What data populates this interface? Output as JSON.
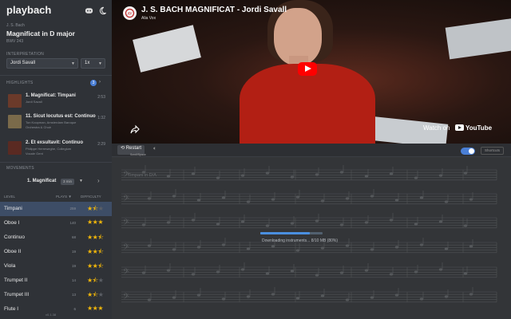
{
  "brand": "playbach",
  "piece": {
    "composer": "J. S. Bach",
    "title": "Magnificat in D major",
    "bwv": "BWV 243"
  },
  "interpretation": {
    "label": "INTERPRETATION",
    "performer": "Jordi Savall",
    "speed": "1x"
  },
  "highlights": {
    "label": "HIGHLIGHTS",
    "count": "3",
    "items": [
      {
        "title": "1. Magnificat: Timpani",
        "sub1": "Jordi Savall",
        "sub2": "",
        "time": "2:53"
      },
      {
        "title": "11. Sicut locutus est: Continuo",
        "sub1": "Ton Koopman, Amsterdam Baroque",
        "sub2": "Orchestra & Choir",
        "time": "1:32"
      },
      {
        "title": "2. Et exsultavit: Continuo",
        "sub1": "Philippe Herreweghe, Collegium",
        "sub2": "Vocale Gent",
        "time": "2:29"
      }
    ]
  },
  "movements": {
    "label": "MOVEMENTS",
    "current": "1. Magnificat",
    "tag": "3 min",
    "next_icon": "chevron-right"
  },
  "table": {
    "col_level": "LEVEL",
    "col_plays": "PLAYS ▼",
    "col_difficulty": "DIFFICULTY",
    "rows": [
      {
        "name": "Timpani",
        "plays": "259",
        "stars": 1,
        "half": true
      },
      {
        "name": "Oboe I",
        "plays": "140",
        "stars": 3,
        "half": false
      },
      {
        "name": "Continuo",
        "plays": "68",
        "stars": 2,
        "half": true
      },
      {
        "name": "Oboe II",
        "plays": "19",
        "stars": 2,
        "half": true
      },
      {
        "name": "Viola",
        "plays": "19",
        "stars": 2,
        "half": true
      },
      {
        "name": "Trumpet II",
        "plays": "14",
        "stars": 1,
        "half": true
      },
      {
        "name": "Trumpet III",
        "plays": "13",
        "stars": 1,
        "half": true
      },
      {
        "name": "Flute I",
        "plays": "6",
        "stars": 3,
        "half": false
      }
    ]
  },
  "version": "v0.1.38",
  "video": {
    "title": "J. S. BACH MAGNIFICAT - Jordi Savall",
    "label": "Alia Vox",
    "watch_on": "Watch on",
    "youtube": "YouTube"
  },
  "score": {
    "restart": "Restart",
    "restart_hint": "Scroll/Space",
    "shortcuts": "Shortcuts",
    "instrument": "Timpani in D/A",
    "progress_text": "Downloading instruments... 8/10 MB (80%)",
    "progress": 0.8
  },
  "colors": {
    "accent": "#4a7fd6",
    "star": "#f2b70a",
    "youtube_red": "#ff0000"
  }
}
